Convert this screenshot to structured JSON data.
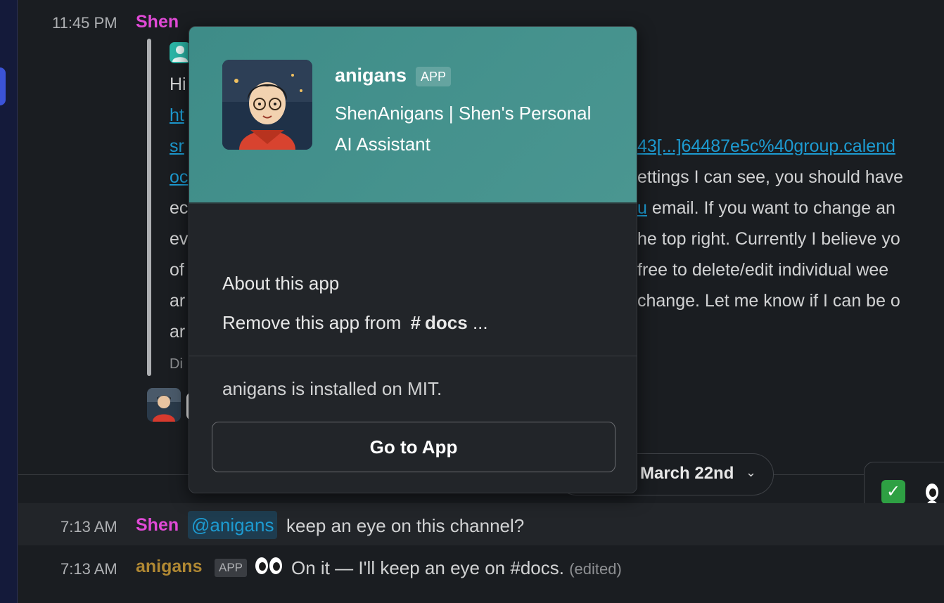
{
  "thread_top": {
    "timestamp": "11:45 PM",
    "sender": "Shen",
    "quoted_fragments": [
      "Hi",
      "ht",
      "sr",
      "oc",
      "ec",
      "ev",
      "of",
      "ar",
      "ar",
      "Di"
    ],
    "visible_right": {
      "link_fragment": "43[...]64487e5c%40group.calend",
      "line2": "ettings I can see, you should have",
      "line3_link": "u",
      "line3_rest": " email. If you want to change an",
      "line4": "he top right. Currently I believe yo",
      "line5": "free to delete/edit individual wee",
      "line6": " change. Let me know if I can be o"
    }
  },
  "date_divider": {
    "label": "March 22nd",
    "chevron": "⌄"
  },
  "reactions": {
    "check": "✓"
  },
  "messages": [
    {
      "timestamp": "7:13 AM",
      "sender": "Shen",
      "mention": "@anigans",
      "text": "keep an eye on this channel?"
    },
    {
      "timestamp": "7:13 AM",
      "sender": "anigans",
      "badge": "APP",
      "text": "On it — I'll keep an eye on #docs.",
      "edited": "(edited)"
    }
  ],
  "popover": {
    "app_name": "anigans",
    "badge": "APP",
    "description": "ShenAnigans | Shen's Personal AI Assistant",
    "about_label": "About this app",
    "remove_prefix": "Remove this app from",
    "remove_channel_hash": "#",
    "remove_channel": "docs",
    "remove_suffix": "...",
    "installed_text": "anigans is installed on MIT.",
    "go_button": "Go to App"
  },
  "colors": {
    "accent_pink": "#e04ad6",
    "app_gold": "#b08833",
    "link_blue": "#1d9bd1",
    "popover_header_teal": "#3e8c88",
    "reaction_green": "#2ea043"
  }
}
